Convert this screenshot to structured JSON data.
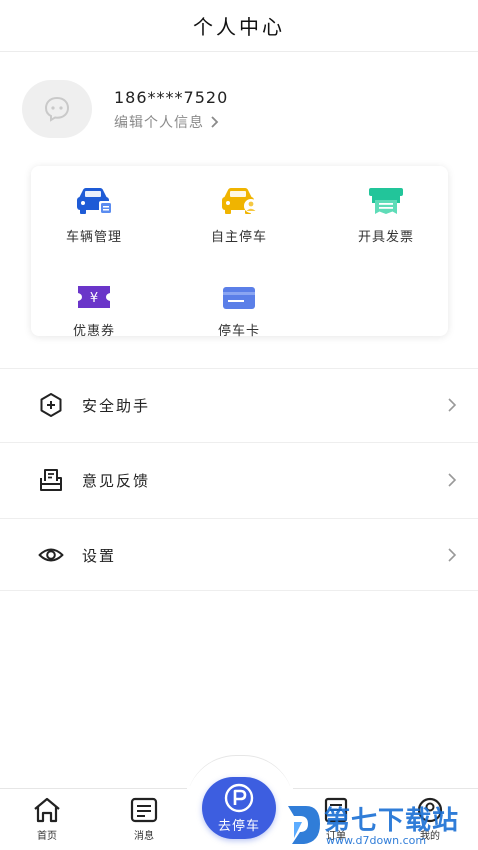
{
  "header": {
    "title": "个人中心"
  },
  "profile": {
    "phone": "186****7520",
    "edit_label": "编辑个人信息"
  },
  "functions": [
    {
      "label": "车辆管理",
      "icon": "car-manage-icon",
      "color": "#1e5bd6"
    },
    {
      "label": "自主停车",
      "icon": "self-parking-icon",
      "color": "#f0b400"
    },
    {
      "label": "开具发票",
      "icon": "invoice-icon",
      "color": "#22c59a"
    },
    {
      "label": "优惠券",
      "icon": "coupon-icon",
      "color": "#6a35c9"
    },
    {
      "label": "停车卡",
      "icon": "parking-card-icon",
      "color": "#5b7fe8"
    }
  ],
  "menu": [
    {
      "label": "安全助手",
      "icon": "shield-plus-icon"
    },
    {
      "label": "意见反馈",
      "icon": "feedback-icon"
    },
    {
      "label": "设置",
      "icon": "eye-settings-icon"
    }
  ],
  "tabbar": {
    "home": "首页",
    "messages": "消息",
    "center_button": "去停车",
    "orders": "订单",
    "mine": "我的"
  },
  "watermark": {
    "text": "第七下载站",
    "url": "www.d7down.com"
  },
  "colors": {
    "accent": "#3d5ee0",
    "text_secondary": "#8a8a8a",
    "divider": "#eeeeee"
  }
}
